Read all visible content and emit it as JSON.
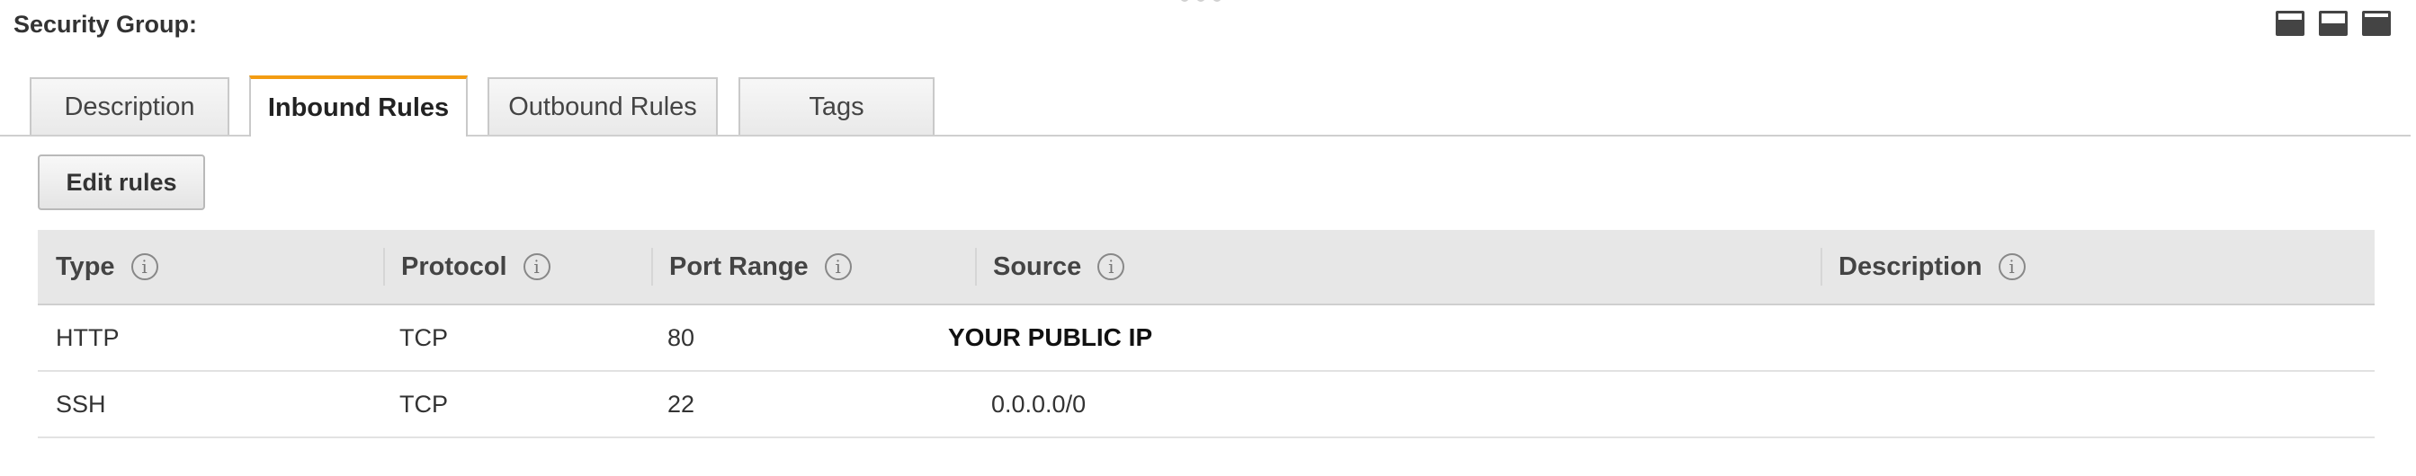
{
  "panel": {
    "title": "Security Group:"
  },
  "layout_controls": [
    {
      "icon": "panel-bottom-icon"
    },
    {
      "icon": "panel-half-icon"
    },
    {
      "icon": "panel-full-icon"
    }
  ],
  "tabs": [
    {
      "label": "Description",
      "active": false
    },
    {
      "label": "Inbound Rules",
      "active": true
    },
    {
      "label": "Outbound Rules",
      "active": false
    },
    {
      "label": "Tags",
      "active": false
    }
  ],
  "toolbar": {
    "edit_rules_label": "Edit rules"
  },
  "table": {
    "columns": [
      "Type",
      "Protocol",
      "Port Range",
      "Source",
      "Description"
    ],
    "info_glyph": "i",
    "rows": [
      {
        "type": "HTTP",
        "protocol": "TCP",
        "port_range": "80",
        "source": "YOUR PUBLIC IP",
        "description": ""
      },
      {
        "type": "SSH",
        "protocol": "TCP",
        "port_range": "22",
        "source": "0.0.0.0/0",
        "description": ""
      }
    ]
  },
  "colors": {
    "active_tab_accent": "#f39c12",
    "header_background": "#e7e7e7"
  }
}
